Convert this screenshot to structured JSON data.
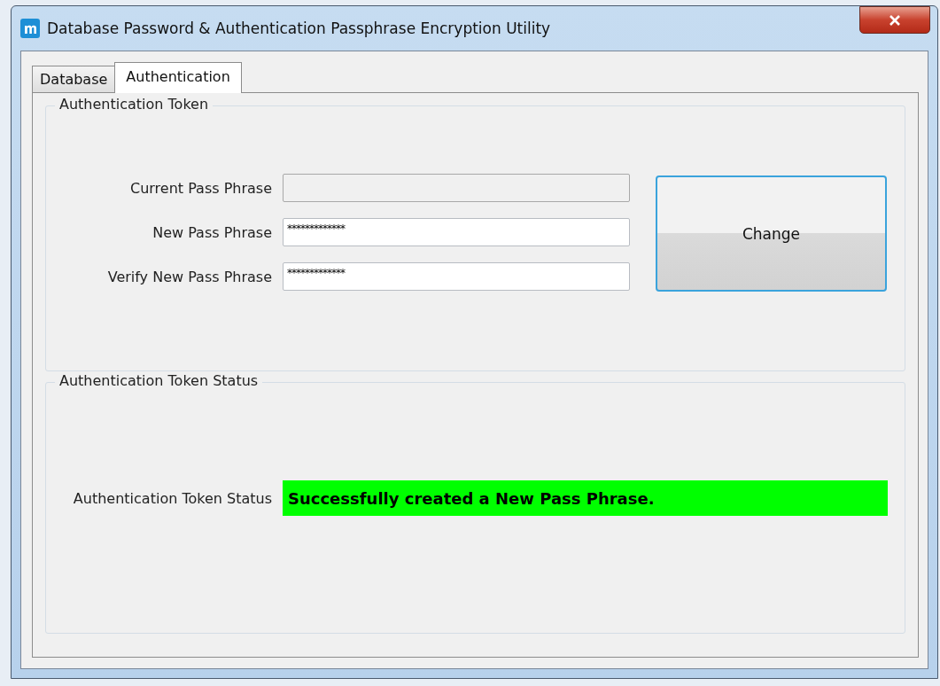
{
  "window": {
    "title": "Database Password & Authentication Passphrase Encryption Utility"
  },
  "tabs": [
    {
      "label": "Database",
      "selected": false
    },
    {
      "label": "Authentication",
      "selected": true
    }
  ],
  "token_group": {
    "title": "Authentication Token",
    "fields": [
      {
        "label": "Current Pass Phrase",
        "disabled": true
      },
      {
        "label": "New Pass Phrase",
        "value": "*************",
        "disabled": false
      },
      {
        "label": "Verify New Pass Phrase",
        "value": "*************",
        "disabled": false
      }
    ],
    "button": "Change"
  },
  "status_group": {
    "title": "Authentication Token Status",
    "label": "Authentication Token Status",
    "message": "Successfully created a New Pass Phrase.",
    "color": "#00ff00"
  }
}
